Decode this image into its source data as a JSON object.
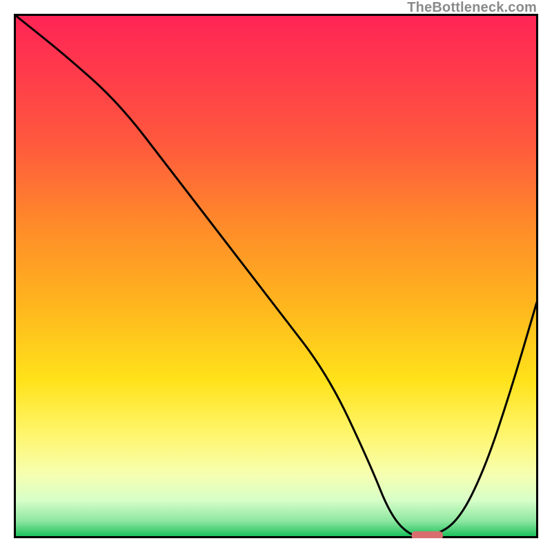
{
  "watermark": "TheBottleneck.com",
  "chart_data": {
    "type": "line",
    "title": "",
    "xlabel": "",
    "ylabel": "",
    "xlim": [
      0,
      100
    ],
    "ylim": [
      0,
      100
    ],
    "series": [
      {
        "name": "curve",
        "x": [
          0,
          10,
          20,
          30,
          40,
          50,
          60,
          68,
          72,
          76,
          80,
          85,
          90,
          95,
          100
        ],
        "y": [
          100,
          92,
          83,
          70,
          57,
          44,
          31,
          14,
          4,
          0,
          0,
          3,
          13,
          28,
          45
        ]
      }
    ],
    "highlight_segment": {
      "x_start": 76,
      "x_end": 82,
      "y": 0,
      "color": "#d86e6e"
    },
    "gradient_stops": [
      {
        "offset": 0.0,
        "color": "#ff2456"
      },
      {
        "offset": 0.12,
        "color": "#ff3d4a"
      },
      {
        "offset": 0.25,
        "color": "#ff5a3d"
      },
      {
        "offset": 0.4,
        "color": "#ff8a2a"
      },
      {
        "offset": 0.55,
        "color": "#ffb41e"
      },
      {
        "offset": 0.7,
        "color": "#ffe21a"
      },
      {
        "offset": 0.8,
        "color": "#fff56a"
      },
      {
        "offset": 0.88,
        "color": "#f6ffb0"
      },
      {
        "offset": 0.93,
        "color": "#d7ffc8"
      },
      {
        "offset": 0.97,
        "color": "#8de6a0"
      },
      {
        "offset": 1.0,
        "color": "#17c05a"
      }
    ]
  }
}
